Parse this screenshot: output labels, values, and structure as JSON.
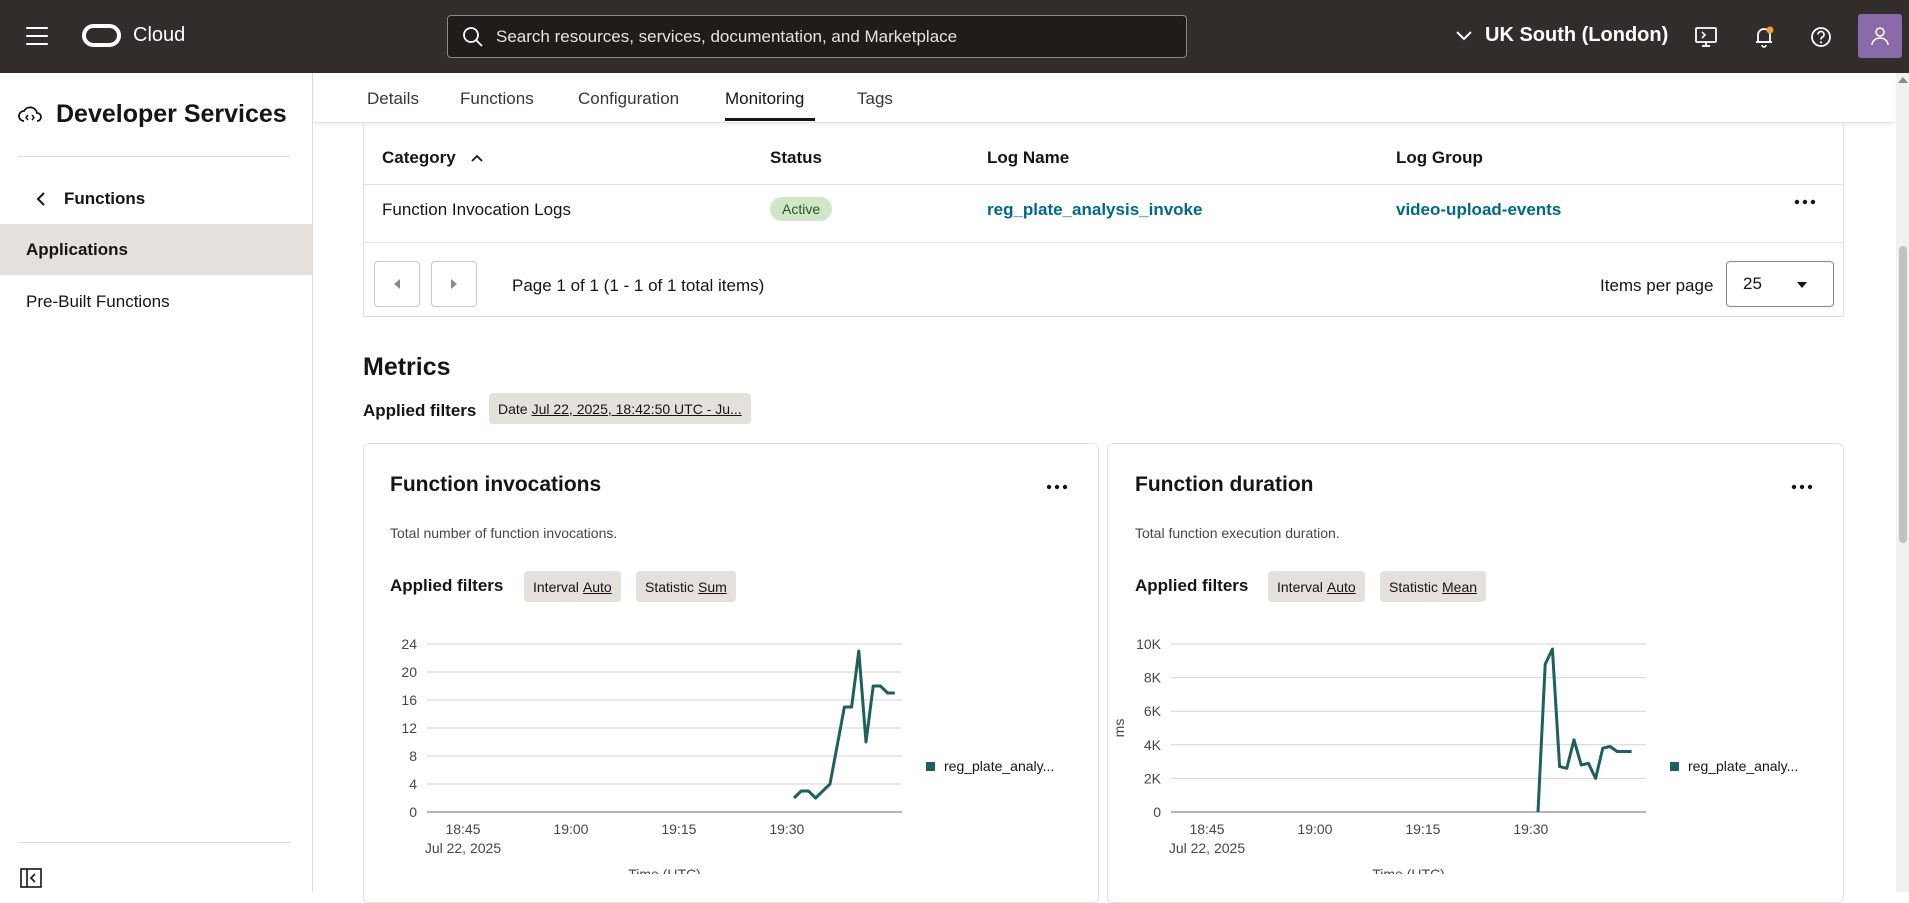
{
  "topbar": {
    "brand": "Cloud",
    "search_placeholder": "Search resources, services, documentation, and Marketplace",
    "region": "UK South (London)",
    "icons": [
      "menu-icon",
      "oracle-logo-icon",
      "search-icon",
      "chevron-down-icon",
      "cloud-shell-icon",
      "bell-icon",
      "help-icon",
      "user-avatar-icon"
    ]
  },
  "sidebar": {
    "title": "Developer Services",
    "back_label": "Functions",
    "items": [
      {
        "label": "Applications",
        "active": true
      },
      {
        "label": "Pre-Built Functions",
        "active": false
      }
    ]
  },
  "tabs": [
    {
      "label": "Details"
    },
    {
      "label": "Functions"
    },
    {
      "label": "Configuration"
    },
    {
      "label": "Monitoring",
      "active": true
    },
    {
      "label": "Tags"
    }
  ],
  "logs_table": {
    "headers": [
      "Category",
      "Status",
      "Log Name",
      "Log Group"
    ],
    "rows": [
      {
        "category": "Function Invocation Logs",
        "status": "Active",
        "log_name": "reg_plate_analysis_invoke",
        "log_group": "video-upload-events"
      }
    ],
    "pagination": "Page 1 of 1 (1 - 1 of 1 total items)",
    "items_per_page_label": "Items per page",
    "items_per_page": "25"
  },
  "metrics": {
    "heading": "Metrics",
    "applied_filters_label": "Applied filters",
    "date_filter_key": "Date",
    "date_filter_value": "Jul 22, 2025, 18:42:50 UTC - Ju..."
  },
  "cards": [
    {
      "title": "Function invocations",
      "description": "Total number of function invocations.",
      "filters_label": "Applied filters",
      "interval_key": "Interval",
      "interval_value": "Auto",
      "statistic_key": "Statistic",
      "statistic_value": "Sum",
      "xlabel": "Time (UTC)",
      "date_label": "Jul 22, 2025",
      "legend": "reg_plate_analy..."
    },
    {
      "title": "Function duration",
      "description": "Total function execution duration.",
      "filters_label": "Applied filters",
      "interval_key": "Interval",
      "interval_value": "Auto",
      "statistic_key": "Statistic",
      "statistic_value": "Mean",
      "xlabel": "Time (UTC)",
      "ylabel": "ms",
      "date_label": "Jul 22, 2025",
      "legend": "reg_plate_analy..."
    }
  ],
  "chart_data": [
    {
      "type": "line",
      "title": "Function invocations",
      "xlabel": "Time (UTC)",
      "ylabel": "",
      "x_ticks": [
        "18:45",
        "19:00",
        "19:15",
        "19:30"
      ],
      "y_ticks": [
        "0",
        "4",
        "8",
        "12",
        "16",
        "20",
        "24"
      ],
      "ylim": [
        0,
        24
      ],
      "xlim_minutes": [
        40,
        106
      ],
      "series": [
        {
          "name": "reg_plate_analy...",
          "color": "#1f5f5f",
          "x": [
            91,
            92,
            93,
            94,
            96,
            98,
            99,
            100,
            101,
            102,
            103,
            104,
            105
          ],
          "y": [
            2,
            3,
            3,
            2,
            4,
            15,
            15,
            23,
            10,
            18,
            18,
            17,
            17
          ]
        }
      ],
      "grid": true,
      "legend_position": "right"
    },
    {
      "type": "line",
      "title": "Function duration",
      "xlabel": "Time (UTC)",
      "ylabel": "ms",
      "x_ticks": [
        "18:45",
        "19:00",
        "19:15",
        "19:30"
      ],
      "y_ticks": [
        "0",
        "2K",
        "4K",
        "6K",
        "8K",
        "10K"
      ],
      "ylim": [
        0,
        10000
      ],
      "xlim_minutes": [
        40,
        106
      ],
      "series": [
        {
          "name": "reg_plate_analy...",
          "color": "#1f5f5f",
          "x": [
            91,
            92,
            93,
            94,
            95,
            96,
            97,
            98,
            99,
            100,
            101,
            102,
            103,
            104
          ],
          "y": [
            0,
            8800,
            9700,
            2700,
            2600,
            4300,
            2800,
            2900,
            2000,
            3800,
            3900,
            3600,
            3600,
            3600
          ]
        }
      ],
      "grid": true,
      "legend_position": "right"
    }
  ]
}
